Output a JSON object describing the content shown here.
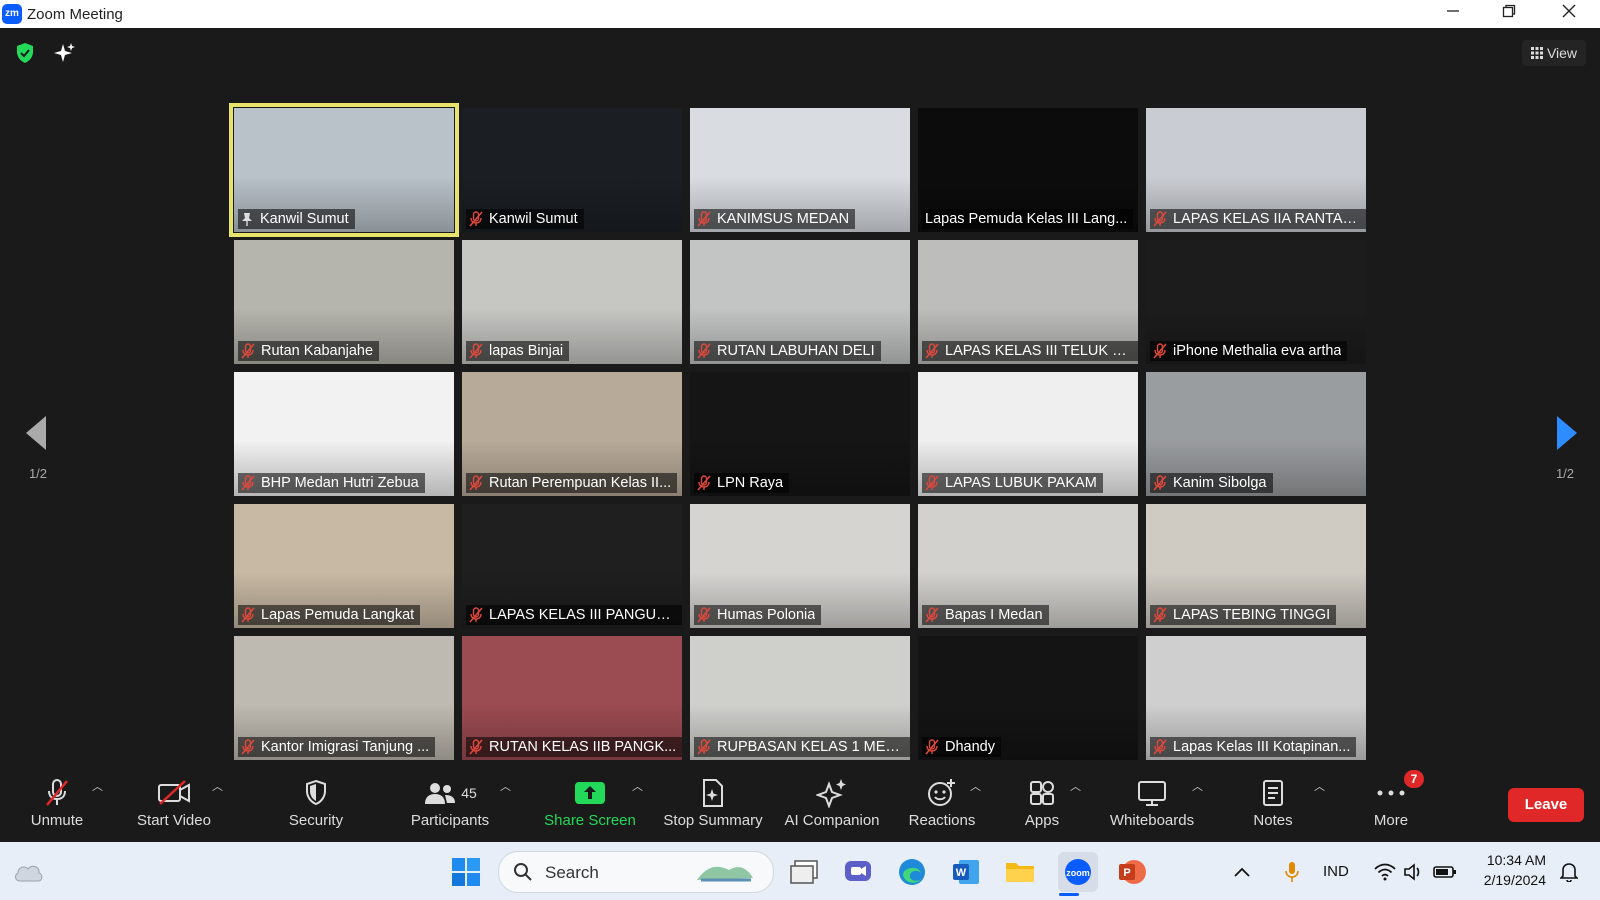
{
  "window": {
    "title": "Zoom Meeting",
    "logo_text": "zm"
  },
  "header": {
    "view_label": "View"
  },
  "pagination": {
    "left": "1/2",
    "right": "1/2"
  },
  "tiles": [
    {
      "name": "Kanwil Sumut",
      "icon": "pin-icon",
      "active": true,
      "bg": "#b9c2c9"
    },
    {
      "name": "Kanwil Sumut",
      "icon": "mic-off-icon",
      "active": false,
      "bg": "#1b1f24"
    },
    {
      "name": "KANIMSUS MEDAN",
      "icon": "mic-off-icon",
      "active": false,
      "bg": "#d9dde2"
    },
    {
      "name": "Lapas Pemuda Kelas III Lang...",
      "icon": "none",
      "active": false,
      "bg": "#0c0c0c"
    },
    {
      "name": "LAPAS KELAS IIA RANTAU...",
      "icon": "mic-off-icon",
      "active": false,
      "bg": "#c9ccd2"
    },
    {
      "name": "Rutan Kabanjahe",
      "icon": "mic-off-icon",
      "active": false,
      "bg": "#b5b4ad"
    },
    {
      "name": "lapas Binjai",
      "icon": "mic-off-icon",
      "active": false,
      "bg": "#c6c7c3"
    },
    {
      "name": "RUTAN LABUHAN DELI",
      "icon": "mic-off-icon",
      "active": false,
      "bg": "#c3c5c4"
    },
    {
      "name": "LAPAS KELAS III TELUK D...",
      "icon": "mic-off-icon",
      "active": false,
      "bg": "#bdbebb"
    },
    {
      "name": "iPhone Methalia eva artha",
      "icon": "mic-off-icon",
      "active": false,
      "bg": "#1c1c1c"
    },
    {
      "name": "BHP Medan Hutri Zebua",
      "icon": "mic-off-icon",
      "active": false,
      "bg": "#f2f2f2"
    },
    {
      "name": "Rutan Perempuan Kelas II...",
      "icon": "mic-off-icon",
      "active": false,
      "bg": "#b8aa98"
    },
    {
      "name": "LPN Raya",
      "icon": "mic-off-icon",
      "active": false,
      "bg": "#151515"
    },
    {
      "name": "LAPAS LUBUK PAKAM",
      "icon": "mic-off-icon",
      "active": false,
      "bg": "#efefef"
    },
    {
      "name": "Kanim Sibolga",
      "icon": "mic-off-icon",
      "active": false,
      "bg": "#9a9d9f"
    },
    {
      "name": "Lapas Pemuda Langkat",
      "icon": "mic-off-icon",
      "active": false,
      "bg": "#c8b9a4"
    },
    {
      "name": "LAPAS KELAS III PANGUR...",
      "icon": "mic-off-icon",
      "active": false,
      "bg": "#1f1f1f"
    },
    {
      "name": "Humas Polonia",
      "icon": "mic-off-icon",
      "active": false,
      "bg": "#d6d4d1"
    },
    {
      "name": "Bapas I Medan",
      "icon": "mic-off-icon",
      "active": false,
      "bg": "#d2d1cd"
    },
    {
      "name": "LAPAS TEBING TINGGI",
      "icon": "mic-off-icon",
      "active": false,
      "bg": "#cfcac2"
    },
    {
      "name": "Kantor Imigrasi Tanjung ...",
      "icon": "mic-off-icon",
      "active": false,
      "bg": "#bfbab1"
    },
    {
      "name": "RUTAN KELAS IIB PANGK...",
      "icon": "mic-off-icon",
      "active": false,
      "bg": "#9b4b52"
    },
    {
      "name": "RUPBASAN KELAS 1 MED...",
      "icon": "mic-off-icon",
      "active": false,
      "bg": "#cfcfcc"
    },
    {
      "name": "Dhandy",
      "icon": "mic-off-icon",
      "active": false,
      "bg": "#141414"
    },
    {
      "name": "Lapas Kelas III Kotapinan...",
      "icon": "mic-off-icon",
      "active": false,
      "bg": "#cfcfcf"
    }
  ],
  "toolbar": {
    "unmute": "Unmute",
    "start_video": "Start Video",
    "security": "Security",
    "participants": "Participants",
    "participants_count": "45",
    "share_screen": "Share Screen",
    "stop_summary": "Stop Summary",
    "ai_companion": "AI Companion",
    "reactions": "Reactions",
    "apps": "Apps",
    "whiteboards": "Whiteboards",
    "notes": "Notes",
    "more": "More",
    "more_badge": "7",
    "leave": "Leave"
  },
  "taskbar": {
    "search_label": "Search",
    "language": "IND",
    "time": "10:34 AM",
    "date": "2/19/2024"
  },
  "colors": {
    "accent_green": "#23d959",
    "leave_red": "#e02828",
    "active_outline": "#e8e36a",
    "nav_blue": "#2d8cff"
  }
}
